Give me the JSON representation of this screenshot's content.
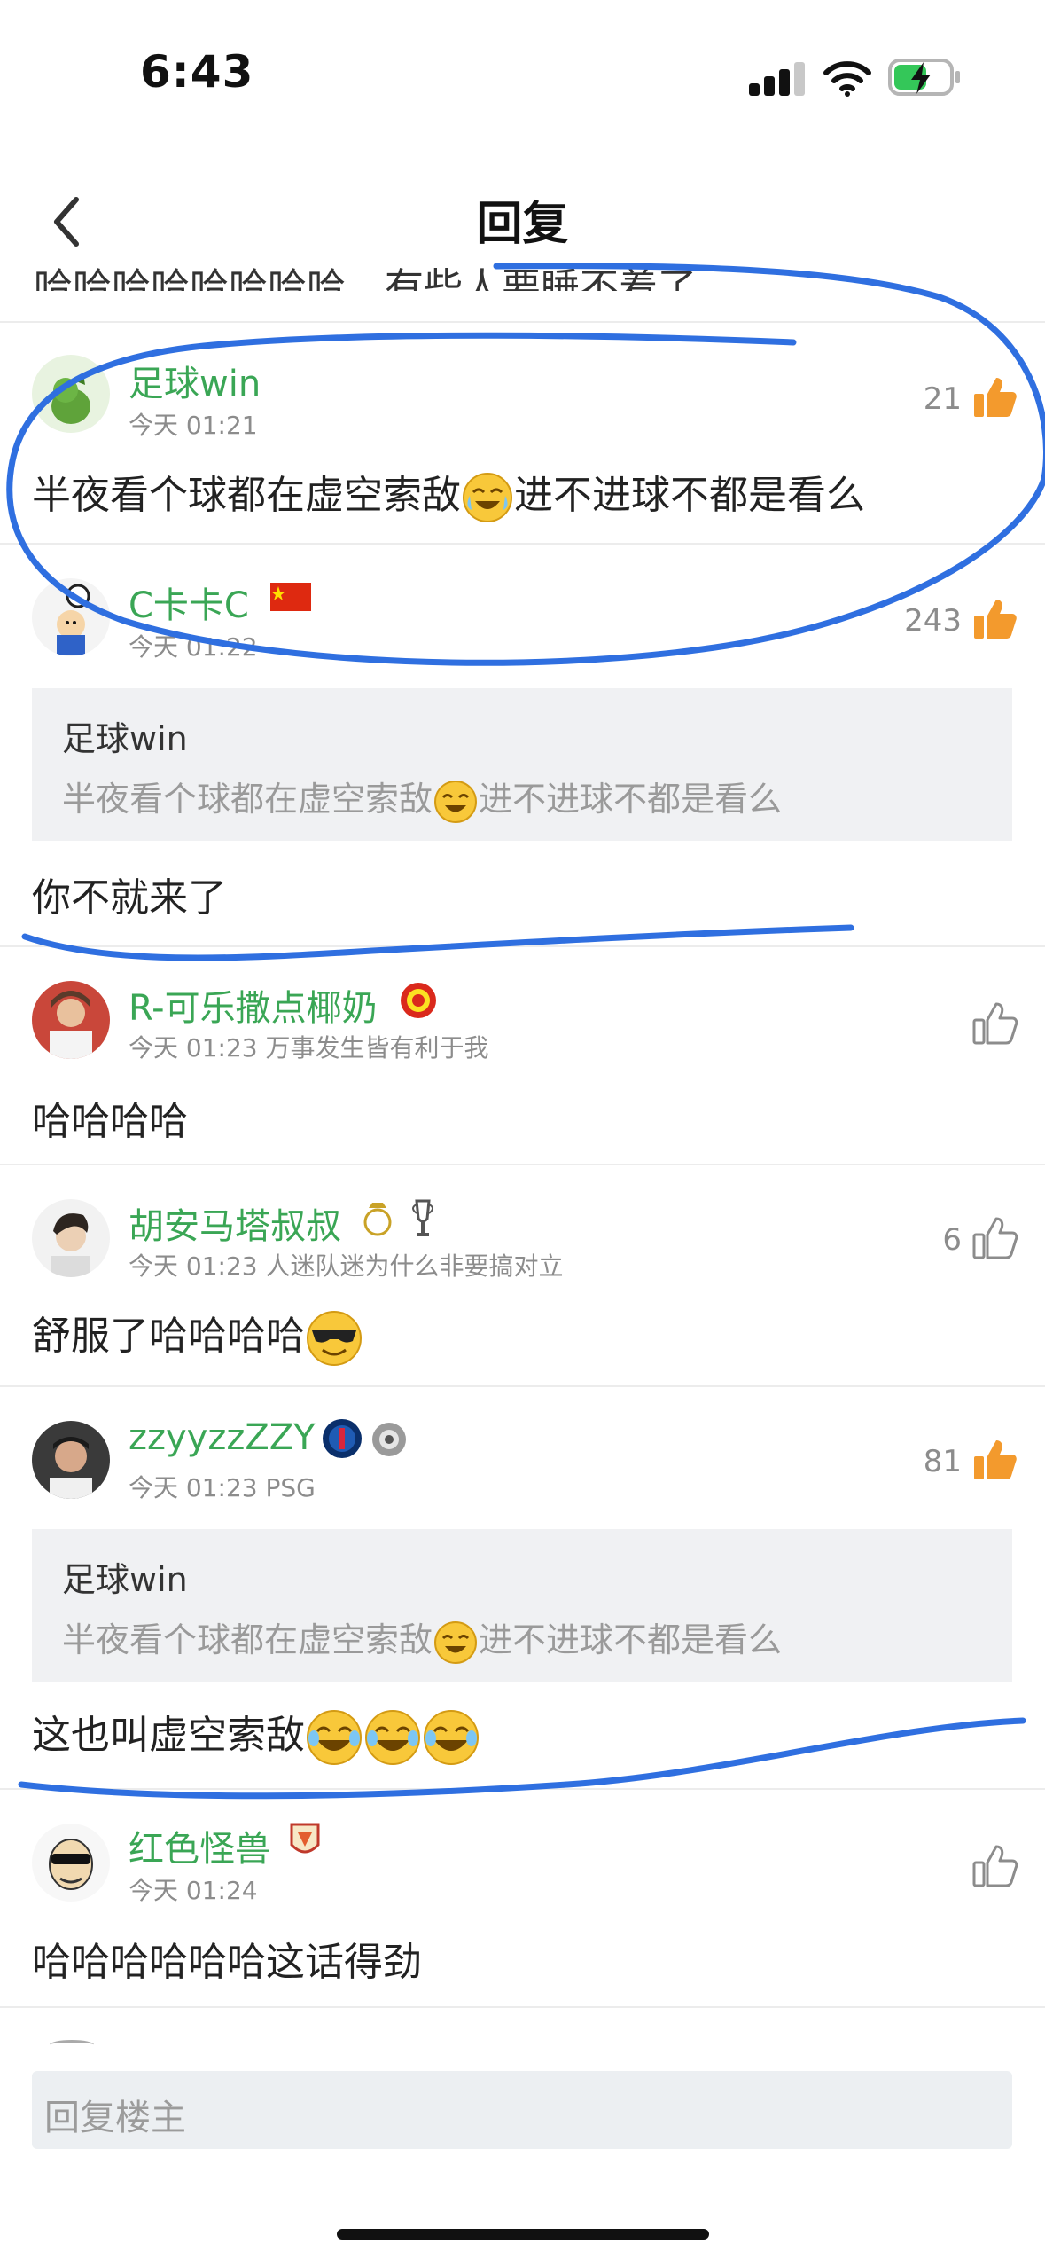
{
  "status_bar": {
    "time": "6:43"
  },
  "nav": {
    "title": "回复"
  },
  "partial_text": "哈哈哈哈哈哈哈哈。有些人要睡不着了",
  "comments": [
    {
      "user": "足球win",
      "time": "今天 01:21",
      "likes": "21",
      "text_a": "半夜看个球都在虚空索敌",
      "text_b": "进不进球不都是看么"
    },
    {
      "user": "C卡卡C",
      "time": "今天 01:22",
      "likes": "243",
      "quote_user": "足球win",
      "quote_a": "半夜看个球都在虚空索敌",
      "quote_b": "进不进球不都是看么",
      "text": "你不就来了"
    },
    {
      "user": "R-可乐撒点椰奶",
      "time": "今天 01:23",
      "signature": "万事发生皆有利于我",
      "text": "哈哈哈哈"
    },
    {
      "user": "胡安马塔叔叔",
      "time": "今天 01:23",
      "signature": "人迷队迷为什么非要搞对立",
      "likes": "6",
      "text": "舒服了哈哈哈哈"
    },
    {
      "user": "zzyyzzZZY",
      "time": "今天 01:23",
      "signature": "PSG",
      "likes": "81",
      "quote_user": "足球win",
      "quote_a": "半夜看个球都在虚空索敌",
      "quote_b": "进不进球不都是看么",
      "text": "这也叫虚空索敌"
    },
    {
      "user": "红色怪兽",
      "time": "今天 01:24",
      "text": "哈哈哈哈哈哈这话得劲"
    }
  ],
  "reply": {
    "placeholder": "回复楼主"
  },
  "colors": {
    "username": "#3aa655",
    "liked": "#f39a2d",
    "annotation": "#2f6fe0"
  }
}
